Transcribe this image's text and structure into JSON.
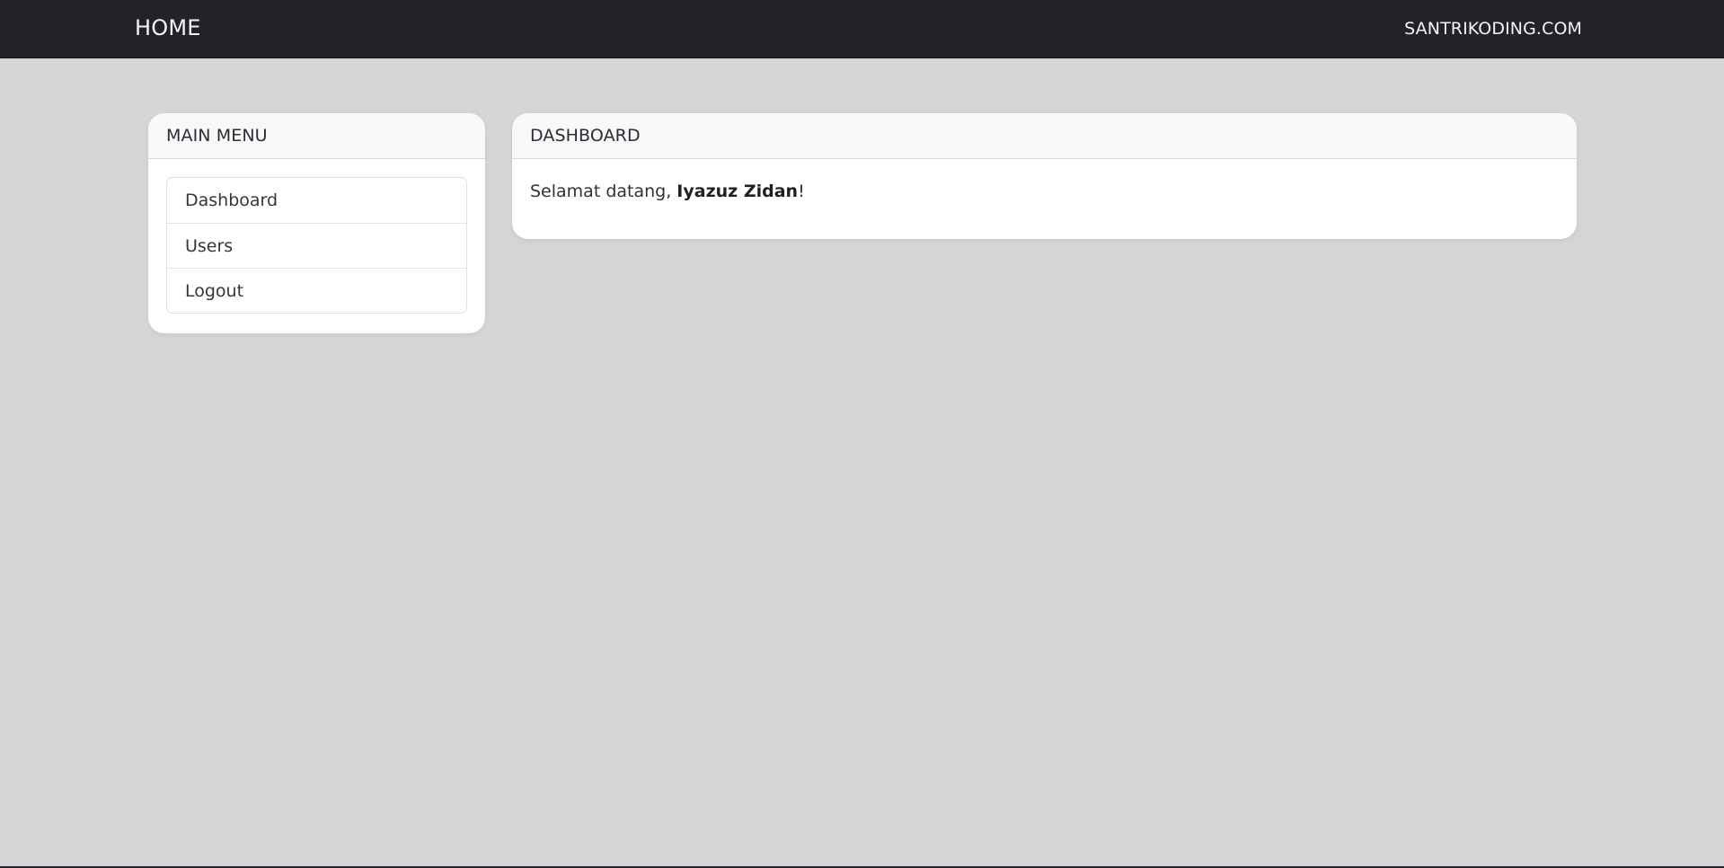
{
  "navbar": {
    "home_label": "HOME",
    "site_label": "SANTRIKODING.COM"
  },
  "sidebar": {
    "title": "MAIN MENU",
    "items": [
      {
        "label": "Dashboard"
      },
      {
        "label": "Users"
      },
      {
        "label": "Logout"
      }
    ]
  },
  "dashboard": {
    "title": "DASHBOARD",
    "welcome_prefix": "Selamat datang, ",
    "user_name": "Iyazuz Zidan",
    "welcome_suffix": "!"
  },
  "colors": {
    "page_background": "#d5d4d7",
    "navbar_background": "#212327",
    "card_background": "#ffffff",
    "card_header_background": "#f8f7f9"
  }
}
